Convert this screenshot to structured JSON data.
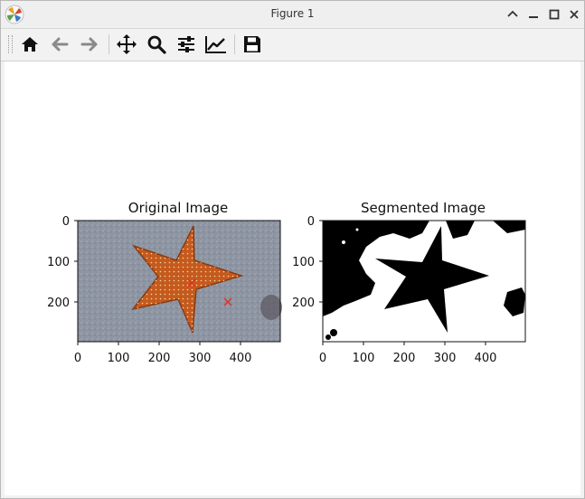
{
  "window": {
    "title": "Figure 1"
  },
  "toolbar": {
    "buttons": [
      "home-icon",
      "back-arrow-icon",
      "forward-arrow-icon",
      "pan-icon",
      "zoom-icon",
      "configure-subplots-icon",
      "edit-axes-icon",
      "save-icon"
    ]
  },
  "figure": {
    "left_title": "Original Image",
    "right_title": "Segmented Image",
    "x_ticks": [
      "0",
      "100",
      "200",
      "300",
      "400"
    ],
    "y_ticks": [
      "0",
      "100",
      "200"
    ],
    "markers": [
      {
        "x": 280,
        "y": 155,
        "color": "#e03020",
        "symbol": "x"
      },
      {
        "x": 370,
        "y": 200,
        "color": "#e03020",
        "symbol": "x"
      }
    ],
    "image_width": 500,
    "image_height": 300
  }
}
